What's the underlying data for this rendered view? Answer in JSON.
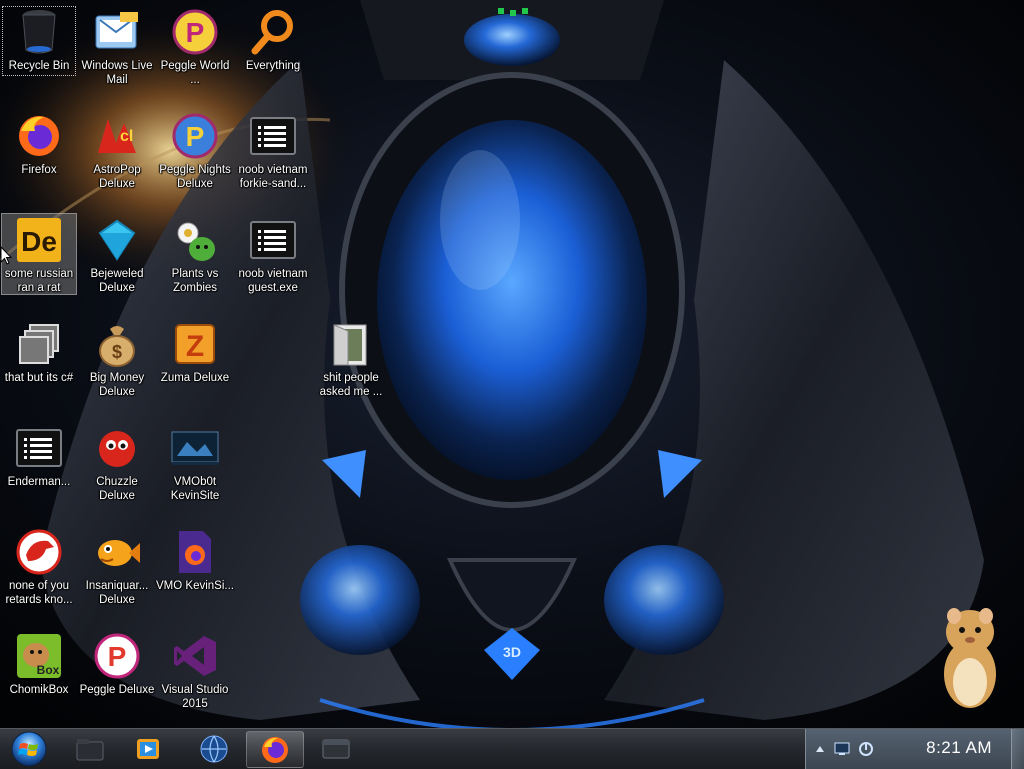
{
  "desktop": {
    "icons": [
      {
        "label": "Recycle Bin",
        "icon": "recycle-bin-icon"
      },
      {
        "label": "Windows Live Mail",
        "icon": "windows-live-mail-icon"
      },
      {
        "label": "Peggle World ...",
        "icon": "peggle-world-icon"
      },
      {
        "label": "Everything",
        "icon": "everything-search-icon"
      },
      {
        "label": "Firefox",
        "icon": "firefox-icon"
      },
      {
        "label": "AstroPop Deluxe",
        "icon": "astropop-icon"
      },
      {
        "label": "Peggle Nights Deluxe",
        "icon": "peggle-nights-icon"
      },
      {
        "label": "noob vietnam forkie-sand...",
        "icon": "console-app-icon"
      },
      {
        "label": "some russian ran a rat",
        "icon": "de-app-icon"
      },
      {
        "label": "Bejeweled Deluxe",
        "icon": "bejeweled-icon"
      },
      {
        "label": "Plants vs Zombies",
        "icon": "plants-vs-zombies-icon"
      },
      {
        "label": "noob vietnam guest.exe",
        "icon": "console-app-icon"
      },
      {
        "label": "that but its c#",
        "icon": "generic-app-icon"
      },
      {
        "label": "Big Money Deluxe",
        "icon": "big-money-icon"
      },
      {
        "label": "Zuma Deluxe",
        "icon": "zuma-icon"
      },
      {
        "label": "shit people asked me ...",
        "icon": "folder-icon"
      },
      {
        "label": "Enderman...",
        "icon": "console-app-icon"
      },
      {
        "label": "Chuzzle Deluxe",
        "icon": "chuzzle-icon"
      },
      {
        "label": "VMOb0t KevinSite",
        "icon": "vm-screenshot-icon"
      },
      {
        "label": "none of you retards kno...",
        "icon": "red-bird-icon"
      },
      {
        "label": "Insaniquar... Deluxe",
        "icon": "insaniquarium-icon"
      },
      {
        "label": "VMO KevinSi...",
        "icon": "firefox-document-icon"
      },
      {
        "label": "ChomikBox",
        "icon": "chomikbox-icon"
      },
      {
        "label": "Peggle Deluxe",
        "icon": "peggle-deluxe-icon"
      },
      {
        "label": "Visual Studio 2015",
        "icon": "visual-studio-icon"
      }
    ]
  },
  "taskbar": {
    "start_icon": "windows-orb-icon",
    "pinned": [
      {
        "icon": "explorer-icon"
      },
      {
        "icon": "media-player-icon"
      },
      {
        "icon": "globe-icon"
      },
      {
        "icon": "firefox-icon",
        "active": true
      },
      {
        "icon": "window-icon"
      }
    ],
    "tray": {
      "icons": [
        "show-hidden-icons-icon",
        "network-icon",
        "action-center-icon"
      ],
      "clock": "8:21 AM"
    }
  },
  "colors": {
    "accent_blue": "#2a7fff",
    "taskbar": "#26292e",
    "tray": "#4a5562"
  }
}
